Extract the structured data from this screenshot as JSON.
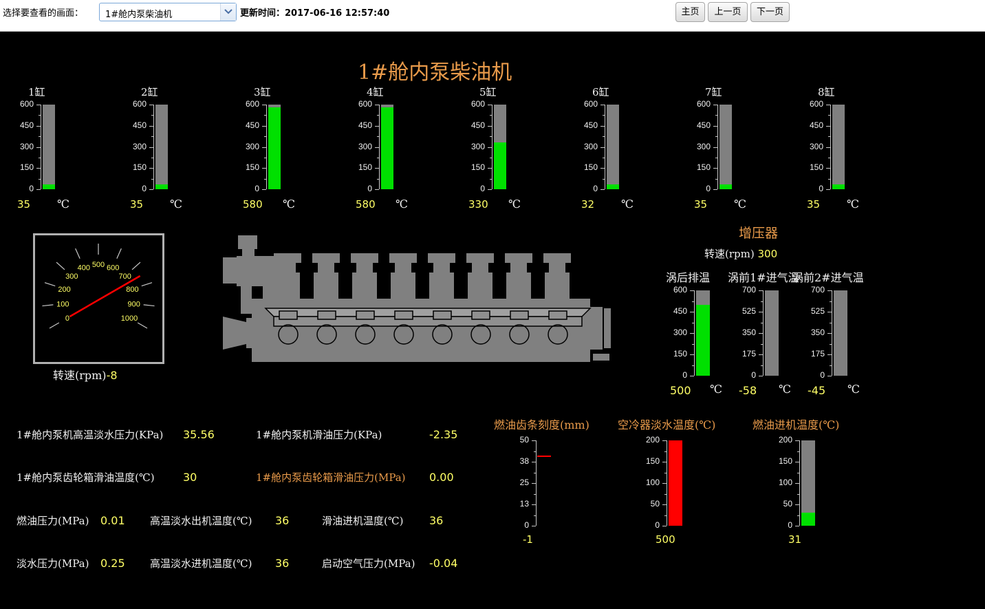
{
  "toolbar": {
    "select_label": "选择要查看的画面：",
    "selected_screen": "1#舱内泵柴油机",
    "update_time": "更新时间：2017-06-16 12:57:40",
    "home": "主页",
    "prev": "上一页",
    "next": "下一页"
  },
  "title": "1#舱内泵柴油机",
  "cylinders": [
    {
      "label": "1缸",
      "value": 35,
      "value_text": "35"
    },
    {
      "label": "2缸",
      "value": 35,
      "value_text": "35"
    },
    {
      "label": "3缸",
      "value": 580,
      "value_text": "580"
    },
    {
      "label": "4缸",
      "value": 580,
      "value_text": "580"
    },
    {
      "label": "5缸",
      "value": 330,
      "value_text": "330"
    },
    {
      "label": "6缸",
      "value": 32,
      "value_text": "32"
    },
    {
      "label": "7缸",
      "value": 35,
      "value_text": "35"
    },
    {
      "label": "8缸",
      "value": 35,
      "value_text": "35"
    }
  ],
  "cyl_scale": {
    "max": 600,
    "ticks": [
      "600",
      "450",
      "300",
      "150",
      "0"
    ]
  },
  "temp_unit": "℃",
  "bar_color_green": "#00e000",
  "bar_color_red": "#ff0000",
  "rpm_gauge": {
    "label": "转速(rpm)",
    "value": "-8",
    "value_num": -8,
    "dial_numbers": [
      "0",
      "100",
      "200",
      "300",
      "400",
      "500",
      "600",
      "700",
      "800",
      "900",
      "1000"
    ]
  },
  "turbo": {
    "title": "增压器",
    "speed_label": "转速(rpm)",
    "speed_value": "300",
    "gauges": [
      {
        "label": "涡后排温",
        "max": 600,
        "ticks": [
          "600",
          "450",
          "300",
          "150",
          "0"
        ],
        "value": 500,
        "value_text": "500"
      },
      {
        "label": "涡前1#进气温",
        "max": 700,
        "ticks": [
          "700",
          "525",
          "350",
          "175",
          "0"
        ],
        "value": -58,
        "value_text": "-58"
      },
      {
        "label": "涡前2#进气温",
        "max": 700,
        "ticks": [
          "700",
          "525",
          "350",
          "175",
          "0"
        ],
        "value": -45,
        "value_text": "-45"
      }
    ]
  },
  "params": {
    "hw_pressure_label": "1#舱内泵机高温淡水压力(KPa)",
    "hw_pressure_value": "35.56",
    "lube_pressure_label": "1#舱内泵机滑油压力(KPa)",
    "lube_pressure_value": "-2.35",
    "gearbox_temp_label": "1#舱内泵齿轮箱滑油温度(℃)",
    "gearbox_temp_value": "30",
    "gearbox_pressure_label": "1#舱内泵齿轮箱滑油压力(MPa)",
    "gearbox_pressure_value": "0.00",
    "fuel_pressure_label": "燃油压力(MPa)",
    "fuel_pressure_value": "0.01",
    "hw_out_temp_label": "高温淡水出机温度(℃)",
    "hw_out_temp_value": "36",
    "lube_in_temp_label": "滑油进机温度(℃)",
    "lube_in_temp_value": "36",
    "fw_pressure_label": "淡水压力(MPa)",
    "fw_pressure_value": "0.25",
    "hw_in_temp_label": "高温淡水进机温度(℃)",
    "hw_in_temp_value": "36",
    "start_air_label": "启动空气压力(MPa)",
    "start_air_value": "-0.04"
  },
  "rack": {
    "label": "燃油齿条刻度(mm)",
    "max": 50,
    "ticks": [
      "50",
      "38",
      "25",
      "13",
      "0"
    ],
    "marker_value": 41,
    "value_text": "-1"
  },
  "cooler": {
    "label": "空冷器淡水温度(℃)",
    "max": 200,
    "ticks": [
      "200",
      "150",
      "100",
      "50",
      "0"
    ],
    "value": 500,
    "value_text": "500"
  },
  "fuel_in": {
    "label": "燃油进机温度(℃)",
    "max": 200,
    "ticks": [
      "200",
      "150",
      "100",
      "50",
      "0"
    ],
    "value": 31,
    "value_text": "31"
  }
}
